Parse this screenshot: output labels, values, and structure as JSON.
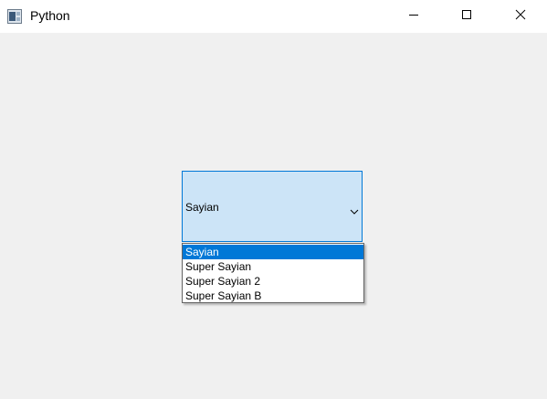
{
  "window": {
    "title": "Python",
    "icons": {
      "app": "python-window-icon",
      "minimize": "minimize-icon",
      "maximize": "maximize-icon",
      "close": "close-icon"
    }
  },
  "combo": {
    "selected_value": "Sayian",
    "arrow_icon": "chevron-down-icon",
    "background_color": "#cce4f7",
    "border_color": "#0078d7"
  },
  "dropdown": {
    "options": [
      {
        "label": "Sayian",
        "selected": true
      },
      {
        "label": "Super Sayian",
        "selected": false
      },
      {
        "label": "Super Sayian 2",
        "selected": false
      },
      {
        "label": "Super Sayian B",
        "selected": false
      }
    ],
    "highlight_color": "#0078d7"
  }
}
